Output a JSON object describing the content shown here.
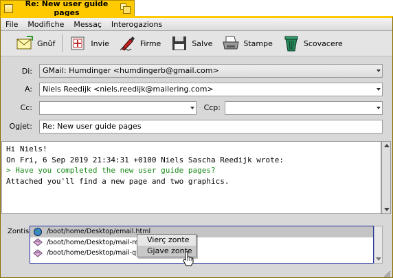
{
  "window": {
    "title": "Re: New user guide pages"
  },
  "menubar": {
    "items": [
      "File",
      "Modifiche",
      "Messaç",
      "Interogazions"
    ]
  },
  "toolbar": {
    "reply_label": "Gnûf",
    "send_label": "Invie",
    "signature_label": "Firme",
    "save_label": "Salve",
    "print_label": "Stampe",
    "trash_label": "Scovacere"
  },
  "headers": {
    "from_label": "Di:",
    "from_value": "GMail:  Humdinger <humdingerb@gmail.com>",
    "to_label": "A:",
    "to_value": "Niels Reedijk <niels.reedijk@mailering.com>",
    "cc_label": "Cc:",
    "cc_value": "",
    "bcc_label": "Ccp:",
    "bcc_value": "",
    "subject_label": "Ogjet:",
    "subject_value": "Re: New user guide pages"
  },
  "body": {
    "line1": "Hi Niels!",
    "line2": "",
    "line3": "On Fri, 6 Sep 2019 21:34:31 +0100 Niels Sascha Reedijk wrote:",
    "quote": "> Have you completed the new user guide pages?",
    "line5": "",
    "line6": "Attached you'll find a new page and two graphics."
  },
  "attachments": {
    "label": "Zontis:",
    "items": [
      "/boot/home/Desktop/email.html",
      "/boot/home/Desktop/mail-read_",
      "/boot/home/Desktop/mail-query_"
    ]
  },
  "context_menu": {
    "items": [
      "Vierç zonte",
      "Gjave zonte"
    ]
  },
  "colors": {
    "title_tab": "#ffcb00",
    "quote_text": "#1a8a1a",
    "selection": "#c4c4c4",
    "list_border": "#2030a0"
  }
}
